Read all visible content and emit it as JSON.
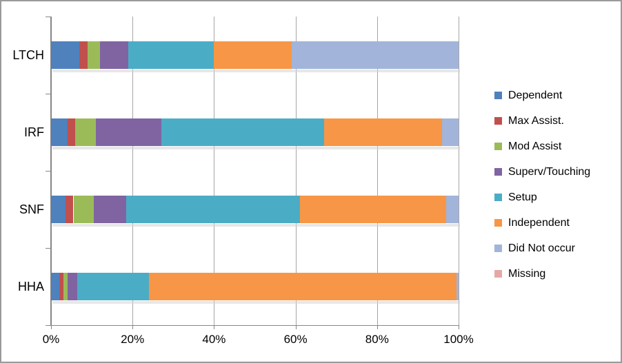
{
  "chart_data": {
    "type": "bar",
    "orientation": "horizontal",
    "stacked": true,
    "normalized_percent": true,
    "title": "",
    "xlabel": "",
    "ylabel": "",
    "xlim": [
      0,
      100
    ],
    "xticks": [
      "0%",
      "20%",
      "40%",
      "60%",
      "80%",
      "100%"
    ],
    "xtick_values": [
      0,
      20,
      40,
      60,
      80,
      100
    ],
    "grid": "vertical",
    "legend_position": "right",
    "categories": [
      "LTCH",
      "IRF",
      "SNF",
      "HHA"
    ],
    "series": [
      {
        "name": "Dependent",
        "color": "#4F81BD",
        "values": [
          7.0,
          4.0,
          3.5,
          2.0
        ]
      },
      {
        "name": "Max Assist.",
        "color": "#C0504D",
        "values": [
          2.0,
          2.0,
          2.0,
          1.0
        ]
      },
      {
        "name": "Mod Assist",
        "color": "#9BBB59",
        "values": [
          3.0,
          5.0,
          5.0,
          1.0
        ]
      },
      {
        "name": "Superv/Touching",
        "color": "#8064A2",
        "values": [
          7.0,
          16.0,
          8.0,
          2.5
        ]
      },
      {
        "name": "Setup",
        "color": "#4BACC6",
        "values": [
          21.0,
          40.0,
          42.5,
          17.5
        ]
      },
      {
        "name": "Independent",
        "color": "#F79646",
        "values": [
          19.0,
          29.0,
          36.0,
          75.5
        ]
      },
      {
        "name": "Did Not occur",
        "color": "#A2B4D9",
        "values": [
          41.0,
          4.0,
          3.0,
          0.5
        ]
      },
      {
        "name": "Missing",
        "color": "#E6A8A5",
        "values": [
          0.0,
          0.0,
          0.0,
          0.0
        ]
      }
    ]
  },
  "legend": {
    "items": [
      {
        "label": "Dependent"
      },
      {
        "label": "Max Assist."
      },
      {
        "label": "Mod Assist"
      },
      {
        "label": "Superv/Touching"
      },
      {
        "label": "Setup"
      },
      {
        "label": "Independent"
      },
      {
        "label": "Did Not occur"
      },
      {
        "label": "Missing"
      }
    ]
  }
}
